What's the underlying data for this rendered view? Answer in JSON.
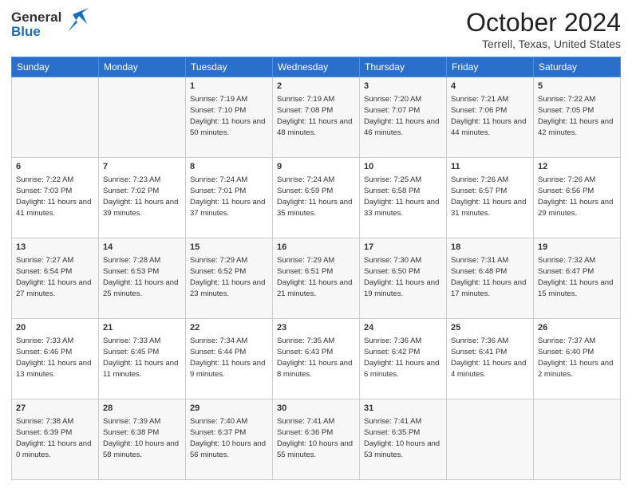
{
  "header": {
    "logo_line1": "General",
    "logo_line2": "Blue",
    "month": "October 2024",
    "location": "Terrell, Texas, United States"
  },
  "weekdays": [
    "Sunday",
    "Monday",
    "Tuesday",
    "Wednesday",
    "Thursday",
    "Friday",
    "Saturday"
  ],
  "weeks": [
    [
      {
        "day": "",
        "sunrise": "",
        "sunset": "",
        "daylight": ""
      },
      {
        "day": "",
        "sunrise": "",
        "sunset": "",
        "daylight": ""
      },
      {
        "day": "1",
        "sunrise": "Sunrise: 7:19 AM",
        "sunset": "Sunset: 7:10 PM",
        "daylight": "Daylight: 11 hours and 50 minutes."
      },
      {
        "day": "2",
        "sunrise": "Sunrise: 7:19 AM",
        "sunset": "Sunset: 7:08 PM",
        "daylight": "Daylight: 11 hours and 48 minutes."
      },
      {
        "day": "3",
        "sunrise": "Sunrise: 7:20 AM",
        "sunset": "Sunset: 7:07 PM",
        "daylight": "Daylight: 11 hours and 46 minutes."
      },
      {
        "day": "4",
        "sunrise": "Sunrise: 7:21 AM",
        "sunset": "Sunset: 7:06 PM",
        "daylight": "Daylight: 11 hours and 44 minutes."
      },
      {
        "day": "5",
        "sunrise": "Sunrise: 7:22 AM",
        "sunset": "Sunset: 7:05 PM",
        "daylight": "Daylight: 11 hours and 42 minutes."
      }
    ],
    [
      {
        "day": "6",
        "sunrise": "Sunrise: 7:22 AM",
        "sunset": "Sunset: 7:03 PM",
        "daylight": "Daylight: 11 hours and 41 minutes."
      },
      {
        "day": "7",
        "sunrise": "Sunrise: 7:23 AM",
        "sunset": "Sunset: 7:02 PM",
        "daylight": "Daylight: 11 hours and 39 minutes."
      },
      {
        "day": "8",
        "sunrise": "Sunrise: 7:24 AM",
        "sunset": "Sunset: 7:01 PM",
        "daylight": "Daylight: 11 hours and 37 minutes."
      },
      {
        "day": "9",
        "sunrise": "Sunrise: 7:24 AM",
        "sunset": "Sunset: 6:59 PM",
        "daylight": "Daylight: 11 hours and 35 minutes."
      },
      {
        "day": "10",
        "sunrise": "Sunrise: 7:25 AM",
        "sunset": "Sunset: 6:58 PM",
        "daylight": "Daylight: 11 hours and 33 minutes."
      },
      {
        "day": "11",
        "sunrise": "Sunrise: 7:26 AM",
        "sunset": "Sunset: 6:57 PM",
        "daylight": "Daylight: 11 hours and 31 minutes."
      },
      {
        "day": "12",
        "sunrise": "Sunrise: 7:26 AM",
        "sunset": "Sunset: 6:56 PM",
        "daylight": "Daylight: 11 hours and 29 minutes."
      }
    ],
    [
      {
        "day": "13",
        "sunrise": "Sunrise: 7:27 AM",
        "sunset": "Sunset: 6:54 PM",
        "daylight": "Daylight: 11 hours and 27 minutes."
      },
      {
        "day": "14",
        "sunrise": "Sunrise: 7:28 AM",
        "sunset": "Sunset: 6:53 PM",
        "daylight": "Daylight: 11 hours and 25 minutes."
      },
      {
        "day": "15",
        "sunrise": "Sunrise: 7:29 AM",
        "sunset": "Sunset: 6:52 PM",
        "daylight": "Daylight: 11 hours and 23 minutes."
      },
      {
        "day": "16",
        "sunrise": "Sunrise: 7:29 AM",
        "sunset": "Sunset: 6:51 PM",
        "daylight": "Daylight: 11 hours and 21 minutes."
      },
      {
        "day": "17",
        "sunrise": "Sunrise: 7:30 AM",
        "sunset": "Sunset: 6:50 PM",
        "daylight": "Daylight: 11 hours and 19 minutes."
      },
      {
        "day": "18",
        "sunrise": "Sunrise: 7:31 AM",
        "sunset": "Sunset: 6:48 PM",
        "daylight": "Daylight: 11 hours and 17 minutes."
      },
      {
        "day": "19",
        "sunrise": "Sunrise: 7:32 AM",
        "sunset": "Sunset: 6:47 PM",
        "daylight": "Daylight: 11 hours and 15 minutes."
      }
    ],
    [
      {
        "day": "20",
        "sunrise": "Sunrise: 7:33 AM",
        "sunset": "Sunset: 6:46 PM",
        "daylight": "Daylight: 11 hours and 13 minutes."
      },
      {
        "day": "21",
        "sunrise": "Sunrise: 7:33 AM",
        "sunset": "Sunset: 6:45 PM",
        "daylight": "Daylight: 11 hours and 11 minutes."
      },
      {
        "day": "22",
        "sunrise": "Sunrise: 7:34 AM",
        "sunset": "Sunset: 6:44 PM",
        "daylight": "Daylight: 11 hours and 9 minutes."
      },
      {
        "day": "23",
        "sunrise": "Sunrise: 7:35 AM",
        "sunset": "Sunset: 6:43 PM",
        "daylight": "Daylight: 11 hours and 8 minutes."
      },
      {
        "day": "24",
        "sunrise": "Sunrise: 7:36 AM",
        "sunset": "Sunset: 6:42 PM",
        "daylight": "Daylight: 11 hours and 6 minutes."
      },
      {
        "day": "25",
        "sunrise": "Sunrise: 7:36 AM",
        "sunset": "Sunset: 6:41 PM",
        "daylight": "Daylight: 11 hours and 4 minutes."
      },
      {
        "day": "26",
        "sunrise": "Sunrise: 7:37 AM",
        "sunset": "Sunset: 6:40 PM",
        "daylight": "Daylight: 11 hours and 2 minutes."
      }
    ],
    [
      {
        "day": "27",
        "sunrise": "Sunrise: 7:38 AM",
        "sunset": "Sunset: 6:39 PM",
        "daylight": "Daylight: 11 hours and 0 minutes."
      },
      {
        "day": "28",
        "sunrise": "Sunrise: 7:39 AM",
        "sunset": "Sunset: 6:38 PM",
        "daylight": "Daylight: 10 hours and 58 minutes."
      },
      {
        "day": "29",
        "sunrise": "Sunrise: 7:40 AM",
        "sunset": "Sunset: 6:37 PM",
        "daylight": "Daylight: 10 hours and 56 minutes."
      },
      {
        "day": "30",
        "sunrise": "Sunrise: 7:41 AM",
        "sunset": "Sunset: 6:36 PM",
        "daylight": "Daylight: 10 hours and 55 minutes."
      },
      {
        "day": "31",
        "sunrise": "Sunrise: 7:41 AM",
        "sunset": "Sunset: 6:35 PM",
        "daylight": "Daylight: 10 hours and 53 minutes."
      },
      {
        "day": "",
        "sunrise": "",
        "sunset": "",
        "daylight": ""
      },
      {
        "day": "",
        "sunrise": "",
        "sunset": "",
        "daylight": ""
      }
    ]
  ]
}
